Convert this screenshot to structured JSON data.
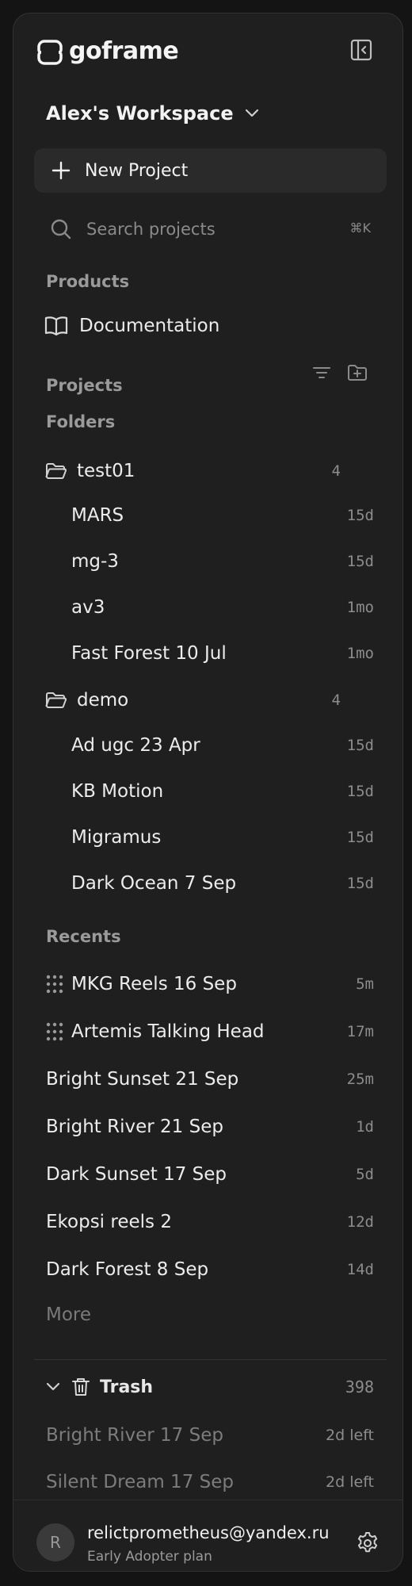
{
  "brand": {
    "name": "goframe"
  },
  "workspace": {
    "name": "Alex's Workspace"
  },
  "actions": {
    "new_project": "New Project"
  },
  "search": {
    "placeholder": "Search projects",
    "shortcut": "⌘K"
  },
  "products": {
    "title": "Products",
    "items": [
      {
        "label": "Documentation",
        "icon": "book-icon"
      }
    ]
  },
  "projects": {
    "title": "Projects"
  },
  "folders": {
    "title": "Folders",
    "items": [
      {
        "name": "test01",
        "count": "4",
        "children": [
          {
            "name": "MARS",
            "age": "15d"
          },
          {
            "name": "mg-3",
            "age": "15d"
          },
          {
            "name": "av3",
            "age": "1mo"
          },
          {
            "name": "Fast Forest 10 Jul",
            "age": "1mo"
          }
        ]
      },
      {
        "name": "demo",
        "count": "4",
        "children": [
          {
            "name": "Ad ugc 23 Apr",
            "age": "15d"
          },
          {
            "name": "KB Motion",
            "age": "15d"
          },
          {
            "name": "Migramus",
            "age": "15d"
          },
          {
            "name": "Dark Ocean 7 Sep",
            "age": "15d"
          }
        ]
      }
    ]
  },
  "recents": {
    "title": "Recents",
    "items": [
      {
        "name": "MKG Reels 16 Sep",
        "age": "5m",
        "icon": "drag-handle-icon"
      },
      {
        "name": "Artemis Talking Head",
        "age": "17m",
        "icon": "drag-handle-icon"
      },
      {
        "name": "Bright Sunset 21 Sep",
        "age": "25m"
      },
      {
        "name": "Bright River 21 Sep",
        "age": "1d"
      },
      {
        "name": "Dark Sunset 17 Sep",
        "age": "5d"
      },
      {
        "name": "Ekopsi reels 2",
        "age": "12d"
      },
      {
        "name": "Dark Forest 8 Sep",
        "age": "14d"
      }
    ],
    "more_label": "More"
  },
  "trash": {
    "title": "Trash",
    "count": "398",
    "items": [
      {
        "name": "Bright River 17 Sep",
        "remaining": "2d left"
      },
      {
        "name": "Silent Dream 17 Sep",
        "remaining": "2d left"
      }
    ]
  },
  "user": {
    "initial": "R",
    "email": "relictprometheus@yandex.ru",
    "plan": "Early Adopter plan"
  },
  "colors": {
    "background": "#1f1f1f",
    "surface": "#2a2a2a",
    "text": "#ececec",
    "muted": "#8c8c8c"
  }
}
